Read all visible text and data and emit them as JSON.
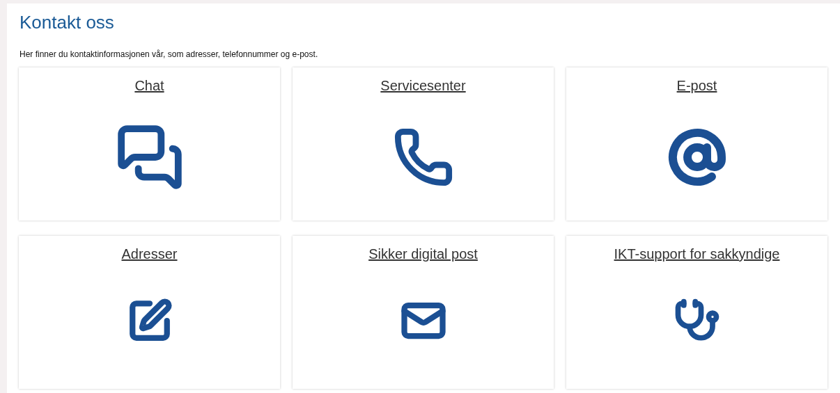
{
  "page": {
    "title": "Kontakt oss",
    "intro": "Her finner du kontaktinformasjonen vår, som adresser, telefonnummer og e-post."
  },
  "cards": [
    {
      "title": "Chat"
    },
    {
      "title": "Servicesenter"
    },
    {
      "title": "E-post"
    },
    {
      "title": "Adresser"
    },
    {
      "title": "Sikker digital post"
    },
    {
      "title": "IKT-support for sakkyndige"
    }
  ]
}
